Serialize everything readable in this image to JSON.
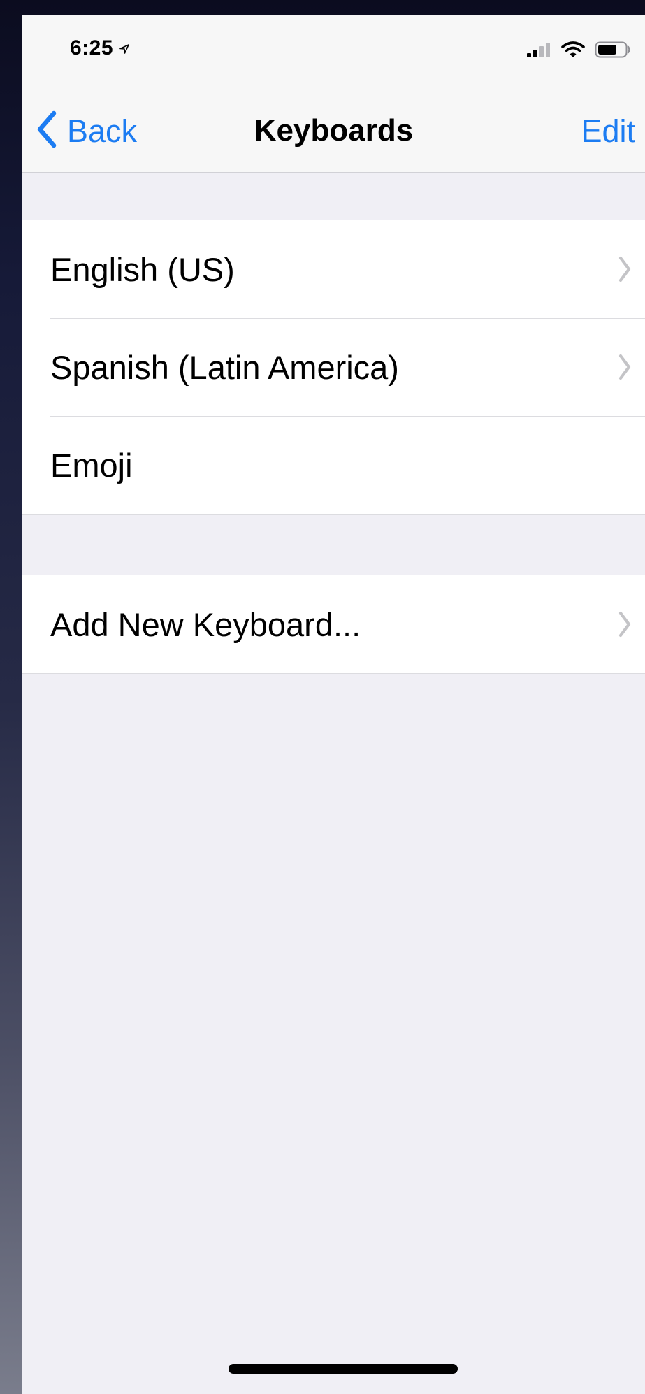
{
  "status_bar": {
    "time": "6:25",
    "icons": [
      "location-arrow-icon",
      "cellular-signal-icon",
      "wifi-icon",
      "battery-icon"
    ]
  },
  "nav": {
    "back_label": "Back",
    "title": "Keyboards",
    "edit_label": "Edit"
  },
  "keyboards": [
    {
      "label": "English (US)",
      "has_chevron": true
    },
    {
      "label": "Spanish (Latin America)",
      "has_chevron": true
    },
    {
      "label": "Emoji",
      "has_chevron": false
    }
  ],
  "add_keyboard": {
    "label": "Add New Keyboard..."
  },
  "colors": {
    "accent": "#1c7cf2",
    "background": "#f0eff5",
    "cell": "#ffffff",
    "separator": "#dcdce0"
  }
}
